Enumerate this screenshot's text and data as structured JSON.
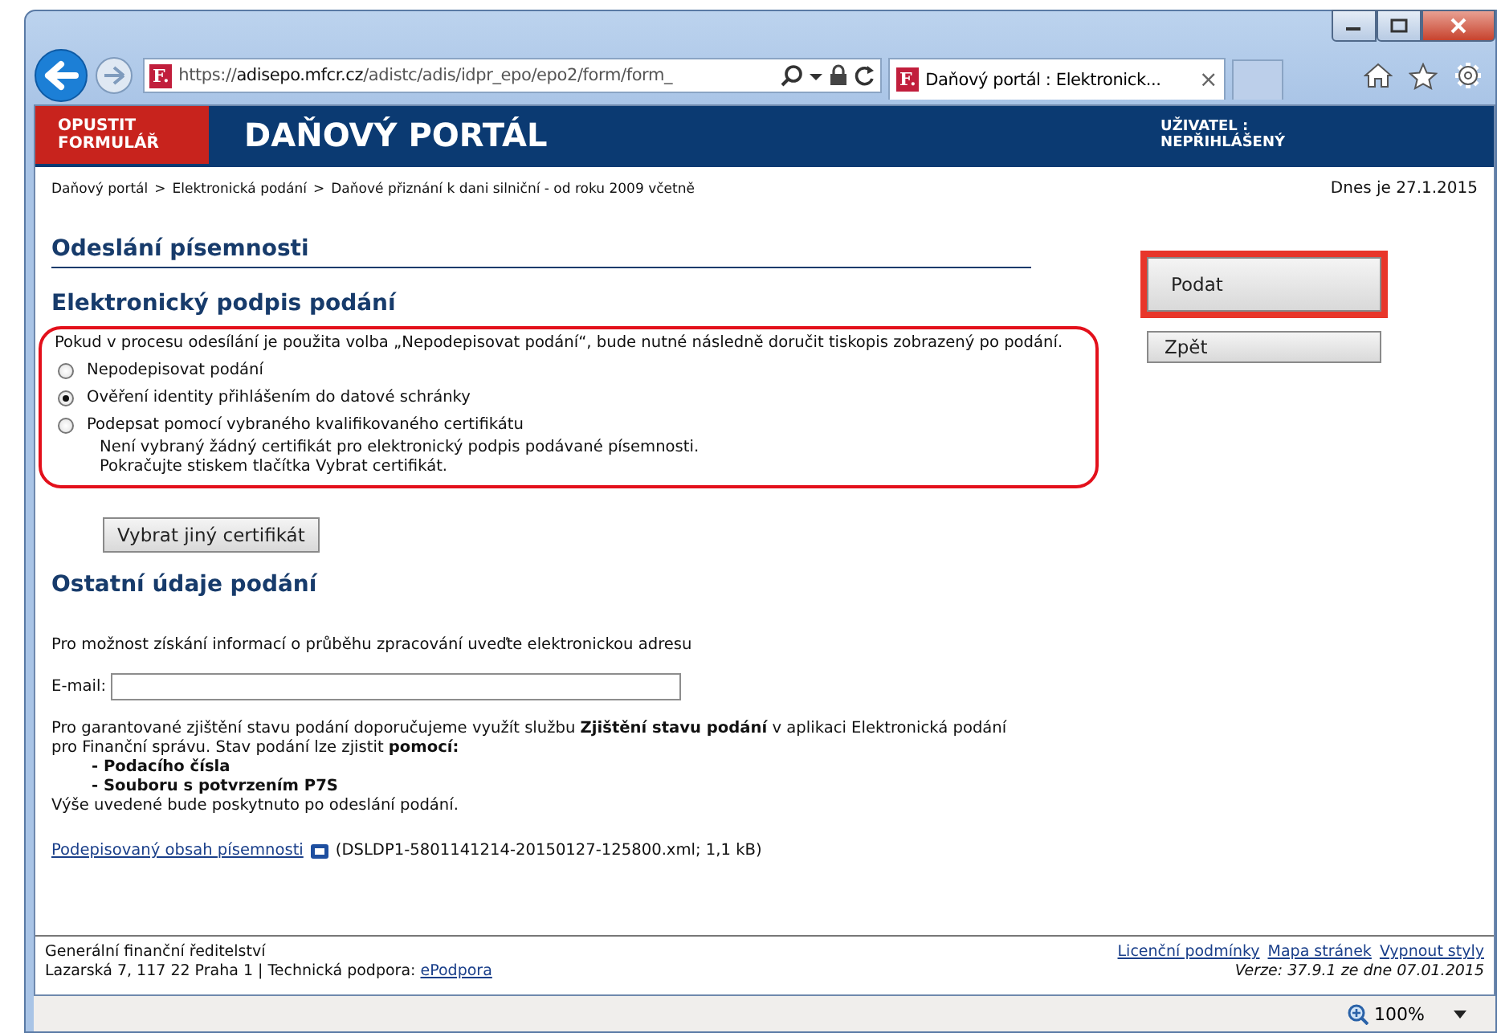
{
  "browser": {
    "url": {
      "scheme": "https://",
      "host": "adisepo.mfcr.cz",
      "path": "/adistc/adis/idpr_epo/epo2/form/form_"
    },
    "favicon": "F.",
    "tab": {
      "favicon": "F.",
      "title": "Daňový portál :  Elektronick...",
      "close": "×",
      "selected": true
    }
  },
  "header": {
    "exit_button": "OPUSTIT FORMULÁŘ",
    "title": "DAŇOVÝ PORTÁL",
    "user_label": "UŽIVATEL :",
    "user_value": "NEPŘIHLÁŠENÝ"
  },
  "breadcrumb": [
    "Daňový portál",
    "Elektronická podání",
    "Daňové přiznání k dani silniční - od roku 2009 včetně"
  ],
  "breadcrumb_separator": ">",
  "date": "Dnes je 27.1.2015",
  "page_title": "Odeslání písemnosti",
  "signature": {
    "title": "Elektronický podpis podání",
    "highlighted": true,
    "note": "Pokud v procesu odesílání je použita volba „Nepodepisovat podání“, bude nutné následně doručit tiskopis zobrazený po podání.",
    "options": [
      {
        "label": "Nepodepisovat podání",
        "selected": false
      },
      {
        "label": "Ověření identity přihlášením do datové schránky",
        "selected": true
      },
      {
        "label": "Podepsat pomocí vybraného kvalifikovaného certifikátu",
        "selected": false,
        "details": [
          "Není vybraný žádný certifikát pro elektronický podpis podávané písemnosti.",
          "Pokračujte stiskem tlačítka Vybrat certifikát."
        ]
      }
    ],
    "button": "Vybrat jiný certifikát"
  },
  "other": {
    "title": "Ostatní údaje podání",
    "info": "Pro možnost získání informací o průběhu zpracování uveďte elektronickou adresu",
    "email_label": "E-mail:",
    "paragraph": "Pro garantované zjištění stavu podání doporučujeme využít službu **Zjištění stavu podání** v aplikaci Elektronická podání pro Finanční správu. Stav podání lze zjistit **pomocí:**",
    "list": [
      "- Podacího čísla",
      "- Souboru s potvrzením P7S"
    ],
    "after": "Výše uvedené bude poskytnuto po odeslání podání.",
    "link": "Podepisovaný obsah písemnosti",
    "file": "(DSLDP1-5801141214-20150127-125800.xml; 1,1 kB)"
  },
  "actions": [
    {
      "label": "Podat",
      "highlighted": true
    },
    {
      "label": "Zpět",
      "highlighted": false
    }
  ],
  "footer": {
    "org": "Generální finanční ředitelství",
    "address": "Lazarská 7, 117 22 Praha 1 | Technická podpora:",
    "support_link": "ePodpora",
    "links": [
      "Licenční podmínky",
      "Mapa stránek",
      "Vypnout styly"
    ],
    "version": "Verze: 37.9.1 ze dne 07.01.2015"
  },
  "status_bar": {
    "zoom": "100%"
  }
}
